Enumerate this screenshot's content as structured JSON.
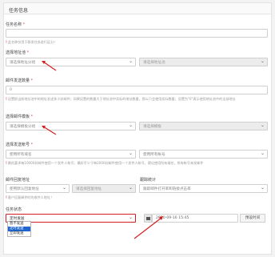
{
  "panel": {
    "title": "任务信息"
  },
  "task_name": {
    "label": "任务名称",
    "required": "*",
    "value": "",
    "hint": "此名称仅用于群发任务进行区分！"
  },
  "address": {
    "label": "选择地址池",
    "required": "*",
    "group_placeholder": "请选择地址分组",
    "pool_placeholder": "请选择地址池"
  },
  "send_count": {
    "label": "邮件发送数量",
    "required": "*",
    "value": "0",
    "hint": "设置即当前地址池中的地址发送多少封邮件；如果设置的数量大于地址池中实际的地址数量，那么只会使用实际数量；设置为\"0\"表示使用地址池中的全部地址"
  },
  "template": {
    "label": "选择邮件模板",
    "required": "*",
    "group_placeholder": "请选择模板分组",
    "template_placeholder": "请选择模板"
  },
  "sender": {
    "label": "选择发送帐号",
    "required": "*",
    "domain_value": "使用所有域名",
    "account_value": "使用所有帐号",
    "hint": "最低要求每10000封邮件使用一个发件人帐号；最好不少于每2000封邮件使用一个发件人帐号，建议使用所有域名，所有帐号来发邮件"
  },
  "reply": {
    "label": "邮件回复地址",
    "mode_value": "使用默认回复地址",
    "address_placeholder": "请选择回复地址",
    "hint": "客户回复邮件时的收件人地址！"
  },
  "tracking": {
    "label": "跟踪统计",
    "value": "跟踪邮件打开率和链接点击率"
  },
  "status": {
    "label": "任务状态",
    "selected": "定时发送",
    "options": [
      "暂不发送",
      "定时发送",
      "立即发送"
    ],
    "active_option": "定时发送",
    "datetime": "2020-09-16 15:45",
    "preset_button": "预设时间"
  },
  "colors": {
    "required": "#d9534f",
    "annotation_arrow": "#d21f1f",
    "dropdown_highlight": "#1e66d0"
  },
  "icons": [
    "chevron-down-icon",
    "calendar-icon",
    "red-arrow-annotation"
  ]
}
